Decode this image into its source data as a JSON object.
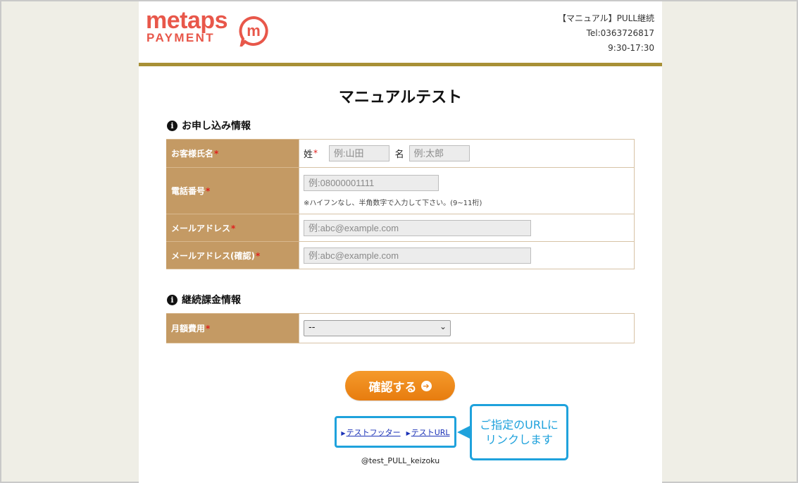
{
  "brand": {
    "line1": "metaps",
    "line2": "PAYMENT",
    "mark": "m",
    "accent": "#e8574a"
  },
  "header": {
    "merchant": "【マニュアル】PULL継続",
    "tel": "Tel:0363726817",
    "hours": "9:30-17:30"
  },
  "page_title": "マニュアルテスト",
  "application_section": {
    "title": "お申し込み情報",
    "required_mark": "*",
    "name_row": {
      "label": "お客様氏名",
      "last_name_label": "姓",
      "last_name_placeholder": "例:山田",
      "first_name_label": "名",
      "first_name_placeholder": "例:太郎"
    },
    "phone_row": {
      "label": "電話番号",
      "placeholder": "例:08000001111",
      "note": "※ハイフンなし、半角数字で入力して下さい。(9~11桁)"
    },
    "email_row": {
      "label": "メールアドレス",
      "placeholder": "例:abc@example.com"
    },
    "email_confirm_row": {
      "label": "メールアドレス(確認)",
      "placeholder": "例:abc@example.com"
    }
  },
  "billing_section": {
    "title": "継続課金情報",
    "monthly_fee_row": {
      "label": "月額費用",
      "selected": "--"
    }
  },
  "confirm_button": {
    "label": "確認する",
    "icon": "arrow-circle-right-icon",
    "color": "#ee8a1c"
  },
  "footer": {
    "links": [
      "テストフッター",
      "テストURL"
    ],
    "callout_line1": "ご指定のURLに",
    "callout_line2": "リンクします",
    "callout_color": "#1fa2dc",
    "copyright": "@test_PULL_keizoku"
  }
}
